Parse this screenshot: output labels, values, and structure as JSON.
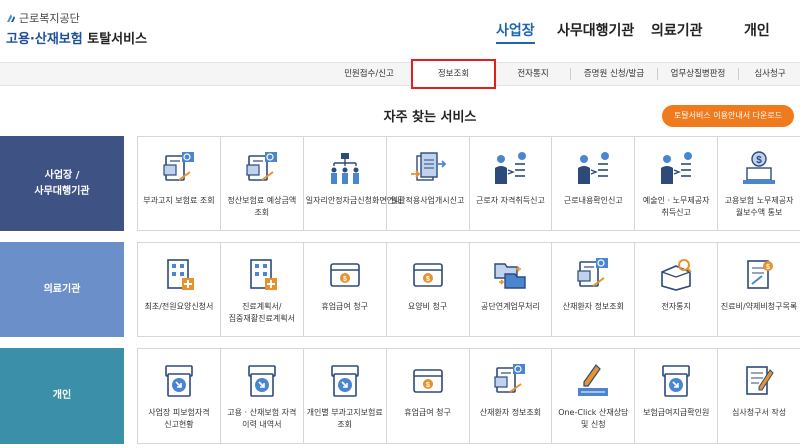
{
  "brand": {
    "org": "근로복지공단",
    "title_blue": "고용·산재보험",
    "title_dark": "토탈서비스"
  },
  "topnav": [
    {
      "label": "사업장",
      "active": true
    },
    {
      "label": "사무대행기관",
      "active": false
    },
    {
      "label": "의료기관",
      "active": false
    },
    {
      "label": "개인",
      "active": false
    }
  ],
  "subnav": [
    {
      "label": "민원접수/신고"
    },
    {
      "label": "정보조회"
    },
    {
      "label": "전자통지"
    },
    {
      "label": "증명원 신청/발급"
    },
    {
      "label": "업무상질병판정"
    },
    {
      "label": "심사청구"
    }
  ],
  "section_title": "자주 찾는 서비스",
  "guide_button": "토탈서비스 이용안내서 다운로드",
  "colors": {
    "accent": "#1d66b3",
    "orange": "#f07a1e",
    "highlight_border": "#e02020",
    "row1": "#3e5283",
    "row2": "#6a8fc9",
    "row3": "#3b8fa8"
  },
  "rows": [
    {
      "label": "사업장 /\n사무대행기관",
      "items": [
        {
          "label": "부과고지 보험료 조회",
          "icon": "document-search-icon"
        },
        {
          "label": "정산보험료 예상금액 조회",
          "icon": "document-search-icon"
        },
        {
          "label": "일자리안정자금신청화면안내",
          "icon": "org-chart-people-icon"
        },
        {
          "label": "일괄적용사업개시신고",
          "icon": "stacked-documents-arrow-icon"
        },
        {
          "label": "근로자 자격취득신고",
          "icon": "person-list-icon"
        },
        {
          "label": "근로내용확인신고",
          "icon": "person-list-icon"
        },
        {
          "label": "예술인 · 노무제공자 취득신고",
          "icon": "person-list-icon"
        },
        {
          "label": "고용보험 노무제공자 월보수액 통보",
          "icon": "laptop-money-icon"
        }
      ]
    },
    {
      "label": "의료기관",
      "items": [
        {
          "label": "최초/전원요양신청서",
          "icon": "hospital-document-icon"
        },
        {
          "label": "진료계획서/집중재활진료계획서",
          "icon": "hospital-document-icon"
        },
        {
          "label": "휴업급여 청구",
          "icon": "money-box-icon"
        },
        {
          "label": "요양비 청구",
          "icon": "money-box-icon"
        },
        {
          "label": "공단연계업무처리",
          "icon": "folder-exchange-icon"
        },
        {
          "label": "산재환자 정보조회",
          "icon": "document-search-icon"
        },
        {
          "label": "전자통지",
          "icon": "box-search-icon"
        },
        {
          "label": "진료비/약제비청구목록",
          "icon": "document-money-icon"
        }
      ]
    },
    {
      "label": "개인",
      "items": [
        {
          "label": "사업장 피보험자격 신고현황",
          "icon": "box-arrow-icon"
        },
        {
          "label": "고용 · 산재보험 자격 이력 내역서",
          "icon": "box-arrow-icon"
        },
        {
          "label": "개인별 부과고지보험료 조회",
          "icon": "box-arrow-icon"
        },
        {
          "label": "휴업급여 청구",
          "icon": "money-box-icon"
        },
        {
          "label": "산재환자 정보조회",
          "icon": "document-search-icon"
        },
        {
          "label": "One-Click 산재상담 및 신청",
          "icon": "pen-touch-icon"
        },
        {
          "label": "보험급여지급확인원",
          "icon": "box-arrow-icon"
        },
        {
          "label": "심사청구서 작성",
          "icon": "document-pen-icon"
        }
      ]
    }
  ]
}
